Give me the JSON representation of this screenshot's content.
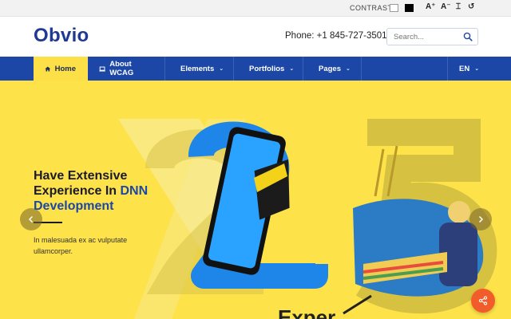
{
  "topbar": {
    "contrast_label": "CONTRAST:",
    "tools": [
      {
        "glyph": "A⁺",
        "name": "increase-font"
      },
      {
        "glyph": "A⁻",
        "name": "decrease-font"
      },
      {
        "glyph": "⌶",
        "name": "text-spacing"
      },
      {
        "glyph": "↺",
        "name": "reset"
      }
    ]
  },
  "header": {
    "logo": "Obvio",
    "phone": "Phone: +1 845-727-3501",
    "search_placeholder": "Search..."
  },
  "nav": {
    "items": [
      {
        "label": "Home",
        "icon": "home-icon",
        "active": true
      },
      {
        "label": "About WCAG",
        "icon": "laptop-icon"
      },
      {
        "label": "Elements",
        "icon": "cube-icon",
        "dropdown": true
      },
      {
        "label": "Portfolios",
        "icon": "image-icon",
        "dropdown": true
      },
      {
        "label": "Pages",
        "icon": "phone-icon",
        "dropdown": true
      }
    ],
    "language": "EN"
  },
  "hero": {
    "heading_line1": "Have Extensive",
    "heading_line2a": "Experience In ",
    "heading_highlight": "DNN",
    "heading_line3": "Development",
    "subtext": "In malesuada ex ac vulputate ullamcorper.",
    "bottom_text": "Exper"
  },
  "colors": {
    "brand_blue": "#1c47a6",
    "hero_yellow": "#fde24a",
    "accent_orange": "#f25c2a"
  }
}
